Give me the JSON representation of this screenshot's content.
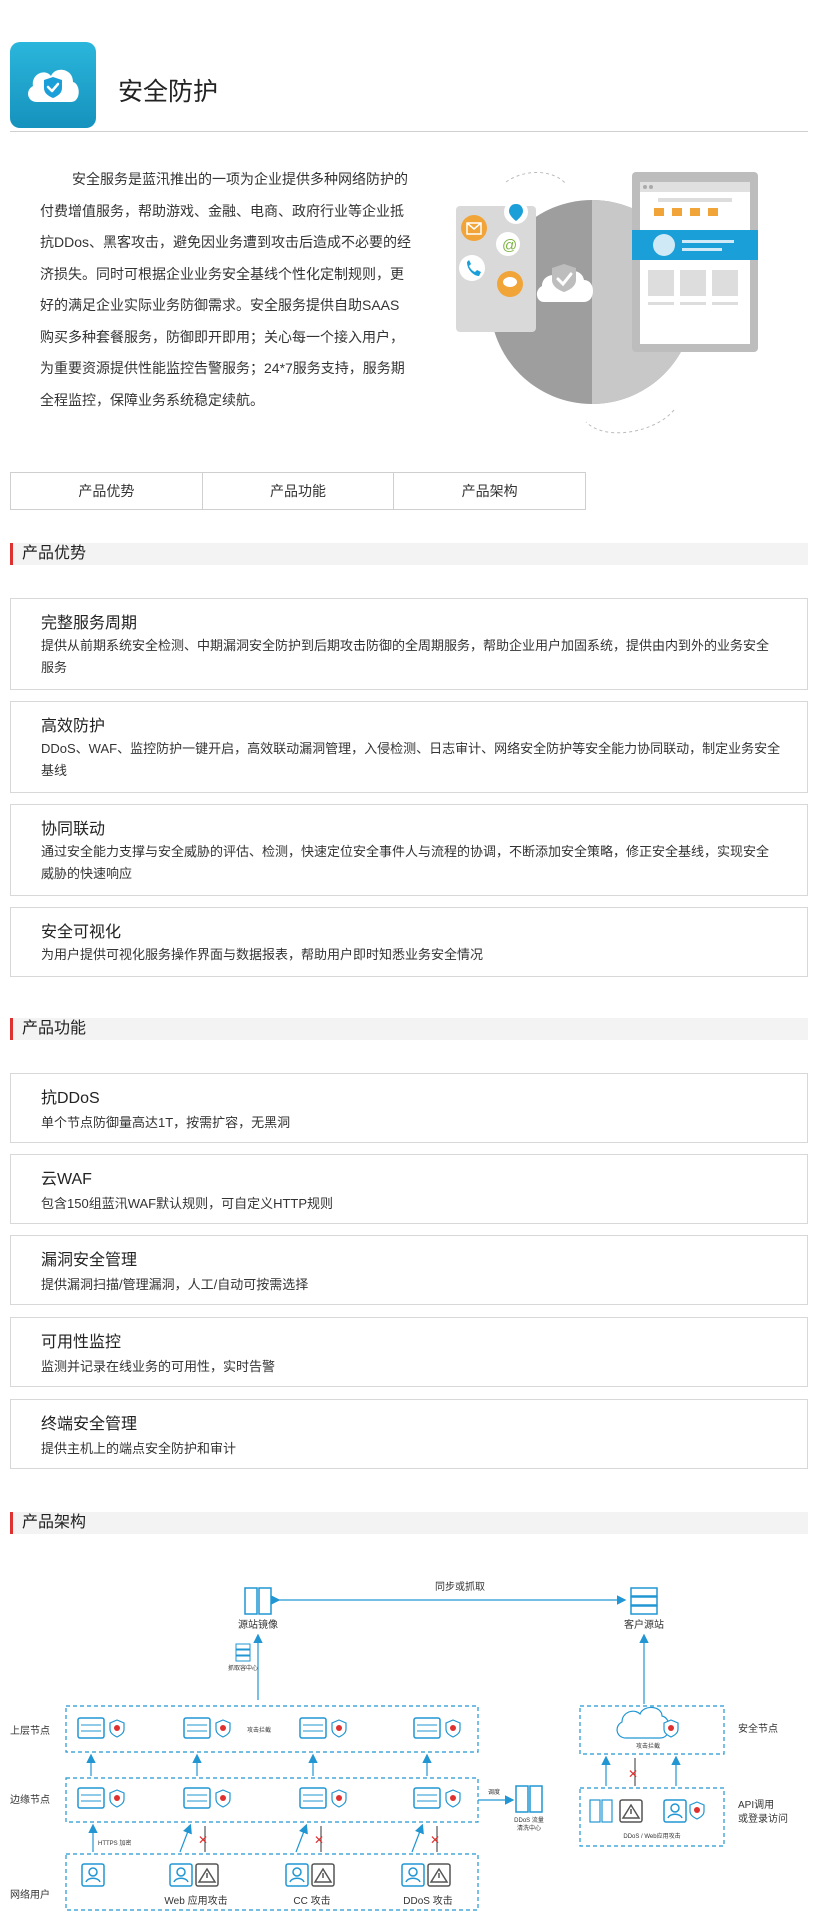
{
  "header": {
    "title": "安全防护",
    "logo_icon": "cloud-shield-icon"
  },
  "intro": "安全服务是蓝汛推出的一项为企业提供多种网络防护的付费增值服务，帮助游戏、金融、电商、政府行业等企业抵抗DDos、黑客攻击，避免因业务遭到攻击后造成不必要的经济损失。同时可根据企业业务安全基线个性化定制规则，更好的满足企业实际业务防御需求。安全服务提供自助SAAS购买多种套餐服务，防御即开即用；关心每一个接入用户，为重要资源提供性能监控告警服务；24*7服务支持，服务期全程监控，保障业务系统稳定续航。",
  "tabs": [
    "产品优势",
    "产品功能",
    "产品架构"
  ],
  "sections": {
    "advantages": {
      "title": "产品优势",
      "items": [
        {
          "title": "完整服务周期",
          "desc": "提供从前期系统安全检测、中期漏洞安全防护到后期攻击防御的全周期服务，帮助企业用户加固系统，提供由内到外的业务安全服务"
        },
        {
          "title": "高效防护",
          "desc": "DDoS、WAF、监控防护一键开启，高效联动漏洞管理，入侵检测、日志审计、网络安全防护等安全能力协同联动，制定业务安全基线"
        },
        {
          "title": "协同联动",
          "desc": "通过安全能力支撑与安全威胁的评估、检测，快速定位安全事件人与流程的协调，不断添加安全策略，修正安全基线，实现安全威胁的快速响应"
        },
        {
          "title": "安全可视化",
          "desc": "为用户提供可视化服务操作界面与数据报表，帮助用户即时知悉业务安全情况"
        }
      ]
    },
    "features": {
      "title": "产品功能",
      "items": [
        {
          "title": "抗DDoS",
          "desc": "单个节点防御量高达1T，按需扩容，无黑洞"
        },
        {
          "title": "云WAF",
          "desc": "包含150组蓝汛WAF默认规则，可自定义HTTP规则"
        },
        {
          "title": "漏洞安全管理",
          "desc": "提供漏洞扫描/管理漏洞，人工/自动可按需选择"
        },
        {
          "title": "可用性监控",
          "desc": "监测并记录在线业务的可用性，实时告警"
        },
        {
          "title": "终端安全管理",
          "desc": "提供主机上的端点安全防护和审计"
        }
      ]
    },
    "architecture": {
      "title": "产品架构"
    }
  },
  "architecture": {
    "sync_label": "同步或抓取",
    "mirror_label": "源站镜像",
    "origin_label": "客户源站",
    "anticopy_label": "抓取容中心",
    "upper_nodes": "上层节点",
    "edge_nodes": "边缘节点",
    "users": "网络用户",
    "security_nodes": "安全节点",
    "api_label_1": "API调用",
    "api_label_2": "或登录访问",
    "attack_block": "攻击拦截",
    "scheduling": "调度",
    "ddos_center_1": "DDoS 流量",
    "ddos_center_2": "清洗中心",
    "https": "HTTPS 加密",
    "web_attack": "Web 应用攻击",
    "cc_attack": "CC 攻击",
    "ddos_attack": "DDoS 攻击",
    "secnode_block": "攻击拦截",
    "ddos_web": "DDoS / Web应用攻击"
  },
  "colors": {
    "accent_blue": "#1a9fd8",
    "brand_red": "#e03131",
    "arrow_blue": "#2196d3"
  }
}
